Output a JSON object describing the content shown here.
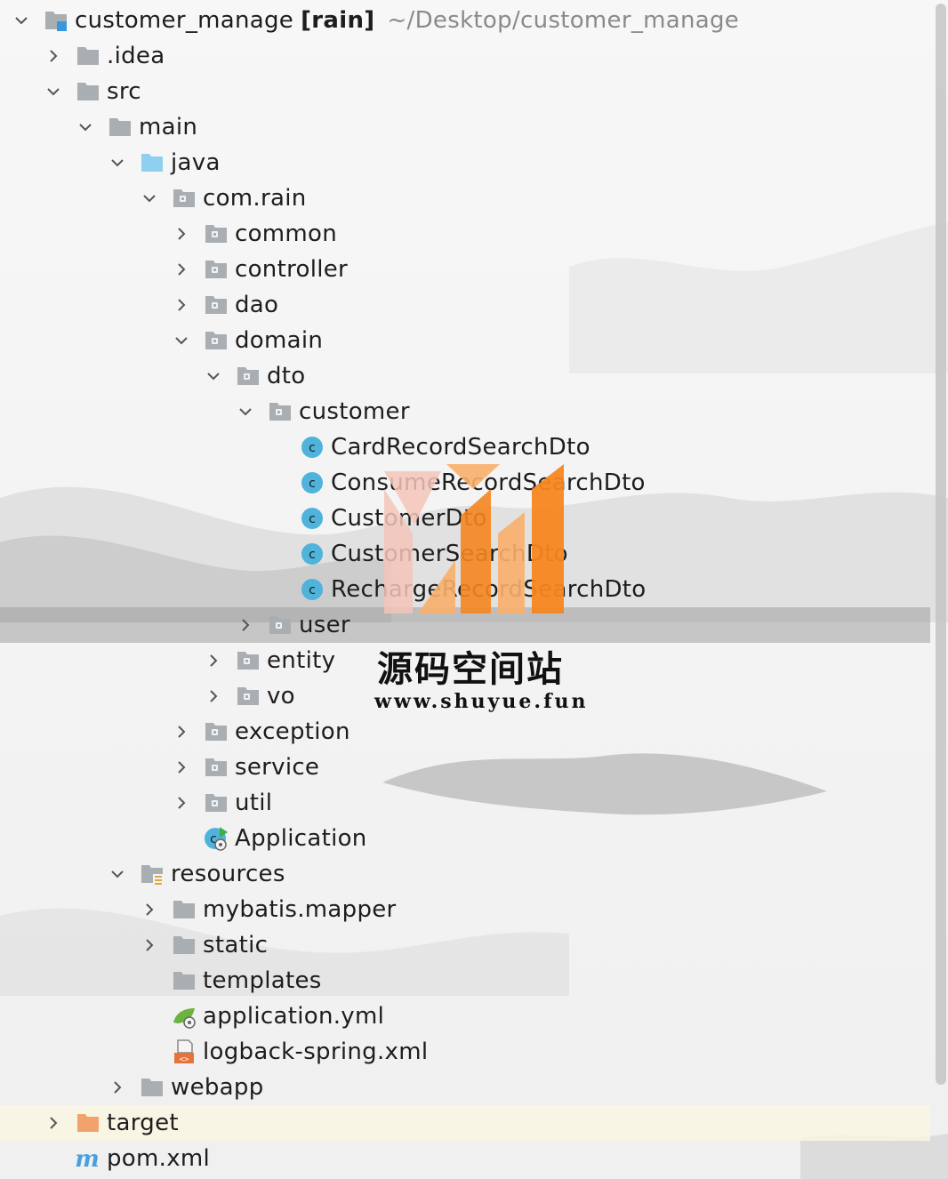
{
  "project": {
    "name": "customer_manage",
    "module": "[rain]",
    "path": "~/Desktop/customer_manage"
  },
  "tree": [
    {
      "depth": 0,
      "expanded": true,
      "icon": "module",
      "label": "customer_manage",
      "root": true,
      "row_state": "normal",
      "name": "tree-root-customer-manage"
    },
    {
      "depth": 1,
      "expanded": false,
      "icon": "folder",
      "label": ".idea",
      "row_state": "normal",
      "name": "tree-item-idea"
    },
    {
      "depth": 1,
      "expanded": true,
      "icon": "folder",
      "label": "src",
      "row_state": "normal",
      "name": "tree-item-src"
    },
    {
      "depth": 2,
      "expanded": true,
      "icon": "folder",
      "label": "main",
      "row_state": "normal",
      "name": "tree-item-main"
    },
    {
      "depth": 3,
      "expanded": true,
      "icon": "folder-source",
      "label": "java",
      "row_state": "normal",
      "name": "tree-item-java"
    },
    {
      "depth": 4,
      "expanded": true,
      "icon": "package",
      "label": "com.rain",
      "row_state": "normal",
      "name": "tree-item-com-rain"
    },
    {
      "depth": 5,
      "expanded": false,
      "icon": "package",
      "label": "common",
      "row_state": "normal",
      "name": "tree-item-common"
    },
    {
      "depth": 5,
      "expanded": false,
      "icon": "package",
      "label": "controller",
      "row_state": "normal",
      "name": "tree-item-controller"
    },
    {
      "depth": 5,
      "expanded": false,
      "icon": "package",
      "label": "dao",
      "row_state": "normal",
      "name": "tree-item-dao"
    },
    {
      "depth": 5,
      "expanded": true,
      "icon": "package",
      "label": "domain",
      "row_state": "normal",
      "name": "tree-item-domain"
    },
    {
      "depth": 6,
      "expanded": true,
      "icon": "package",
      "label": "dto",
      "row_state": "normal",
      "name": "tree-item-dto"
    },
    {
      "depth": 7,
      "expanded": true,
      "icon": "package",
      "label": "customer",
      "row_state": "normal",
      "name": "tree-item-customer"
    },
    {
      "depth": 8,
      "expanded": null,
      "icon": "class",
      "label": "CardRecordSearchDto",
      "row_state": "normal",
      "name": "tree-item-cardrecordsearchdto"
    },
    {
      "depth": 8,
      "expanded": null,
      "icon": "class",
      "label": "ConsumeRecordSearchDto",
      "row_state": "normal",
      "name": "tree-item-consumerecordsearchdto"
    },
    {
      "depth": 8,
      "expanded": null,
      "icon": "class",
      "label": "CustomerDto",
      "row_state": "normal",
      "name": "tree-item-customerdto"
    },
    {
      "depth": 8,
      "expanded": null,
      "icon": "class",
      "label": "CustomerSearchDto",
      "row_state": "normal",
      "name": "tree-item-customersearchdto"
    },
    {
      "depth": 8,
      "expanded": null,
      "icon": "class",
      "label": "RechargeRecordSearchDto",
      "row_state": "normal",
      "name": "tree-item-rechargerecordsearchdto"
    },
    {
      "depth": 7,
      "expanded": false,
      "icon": "package",
      "label": "user",
      "row_state": "selected",
      "name": "tree-item-user"
    },
    {
      "depth": 6,
      "expanded": false,
      "icon": "package",
      "label": "entity",
      "row_state": "normal",
      "name": "tree-item-entity"
    },
    {
      "depth": 6,
      "expanded": false,
      "icon": "package",
      "label": "vo",
      "row_state": "normal",
      "name": "tree-item-vo"
    },
    {
      "depth": 5,
      "expanded": false,
      "icon": "package",
      "label": "exception",
      "row_state": "normal",
      "name": "tree-item-exception"
    },
    {
      "depth": 5,
      "expanded": false,
      "icon": "package",
      "label": "service",
      "row_state": "normal",
      "name": "tree-item-service"
    },
    {
      "depth": 5,
      "expanded": false,
      "icon": "package",
      "label": "util",
      "row_state": "normal",
      "name": "tree-item-util"
    },
    {
      "depth": 5,
      "expanded": null,
      "icon": "spring-app",
      "label": "Application",
      "row_state": "normal",
      "name": "tree-item-application"
    },
    {
      "depth": 3,
      "expanded": true,
      "icon": "folder-resources",
      "label": "resources",
      "row_state": "normal",
      "name": "tree-item-resources"
    },
    {
      "depth": 4,
      "expanded": false,
      "icon": "folder",
      "label": "mybatis.mapper",
      "row_state": "normal",
      "name": "tree-item-mybatis-mapper"
    },
    {
      "depth": 4,
      "expanded": false,
      "icon": "folder",
      "label": "static",
      "row_state": "normal",
      "name": "tree-item-static"
    },
    {
      "depth": 4,
      "expanded": null,
      "icon": "folder",
      "label": "templates",
      "row_state": "normal",
      "name": "tree-item-templates"
    },
    {
      "depth": 4,
      "expanded": null,
      "icon": "yml",
      "label": "application.yml",
      "row_state": "normal",
      "name": "tree-item-application-yml"
    },
    {
      "depth": 4,
      "expanded": null,
      "icon": "xml",
      "label": "logback-spring.xml",
      "row_state": "normal",
      "name": "tree-item-logback-spring-xml"
    },
    {
      "depth": 3,
      "expanded": false,
      "icon": "folder",
      "label": "webapp",
      "row_state": "normal",
      "name": "tree-item-webapp"
    },
    {
      "depth": 1,
      "expanded": false,
      "icon": "folder-excluded",
      "label": "target",
      "row_state": "highlight",
      "name": "tree-item-target"
    },
    {
      "depth": 1,
      "expanded": null,
      "icon": "maven",
      "label": "pom.xml",
      "row_state": "normal",
      "name": "tree-item-pom-xml"
    }
  ],
  "watermark": {
    "title": "源码空间站",
    "url": "www.shuyue.fun"
  },
  "colors": {
    "folder": "#a9aeb3",
    "folder_source": "#8fd0ee",
    "folder_excluded": "#f2a36b",
    "class_icon": "#4fb3dc",
    "selected_row": "#a5a5a5",
    "highlight_row": "#faf6e2",
    "text": "#1d1d1d",
    "path_text": "#8a8a8a",
    "logo_orange": "#f5861f",
    "logo_pink": "#f3c4b8"
  }
}
